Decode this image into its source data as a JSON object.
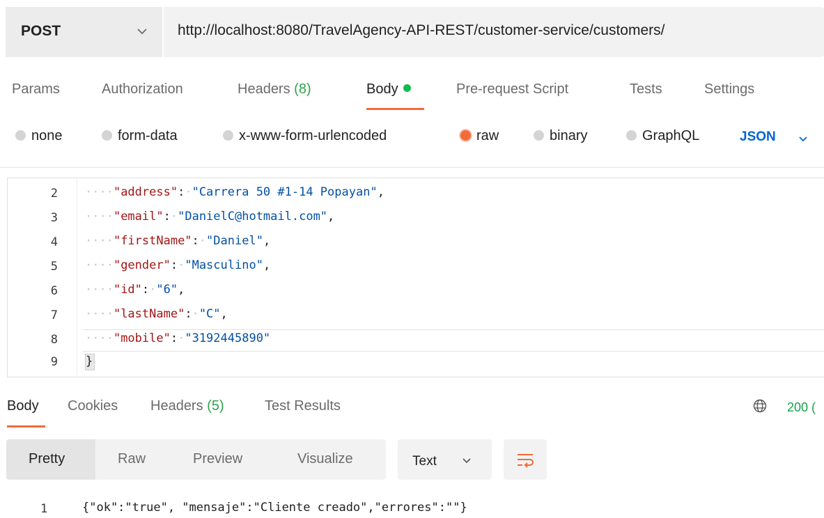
{
  "request": {
    "method": "POST",
    "url": "http://localhost:8080/TravelAgency-API-REST/customer-service/customers/"
  },
  "request_tabs": [
    {
      "label": "Params"
    },
    {
      "label": "Authorization"
    },
    {
      "label": "Headers",
      "count": "(8)"
    },
    {
      "label": "Body"
    },
    {
      "label": "Pre-request Script"
    },
    {
      "label": "Tests"
    },
    {
      "label": "Settings"
    }
  ],
  "body_types": [
    {
      "label": "none"
    },
    {
      "label": "form-data"
    },
    {
      "label": "x-www-form-urlencoded"
    },
    {
      "label": "raw"
    },
    {
      "label": "binary"
    },
    {
      "label": "GraphQL"
    }
  ],
  "body_format": "JSON",
  "editor": {
    "lines": [
      {
        "n": "2",
        "key": "\"address\"",
        "value": "\"Carrera 50 #1-14 Popayan\"",
        "tail": ","
      },
      {
        "n": "3",
        "key": "\"email\"",
        "value": "\"DanielC@hotmail.com\"",
        "tail": ","
      },
      {
        "n": "4",
        "key": "\"firstName\"",
        "value": "\"Daniel\"",
        "tail": ","
      },
      {
        "n": "5",
        "key": "\"gender\"",
        "value": "\"Masculino\"",
        "tail": ","
      },
      {
        "n": "6",
        "key": "\"id\"",
        "value": "\"6\"",
        "tail": ","
      },
      {
        "n": "7",
        "key": "\"lastName\"",
        "value": "\"C\"",
        "tail": ","
      },
      {
        "n": "8",
        "key": "\"mobile\"",
        "value": "\"3192445890\"",
        "tail": ""
      }
    ],
    "last_line": {
      "n": "9",
      "text": "}"
    }
  },
  "response_tabs": [
    {
      "label": "Body"
    },
    {
      "label": "Cookies"
    },
    {
      "label": "Headers",
      "count": "(5)"
    },
    {
      "label": "Test Results"
    }
  ],
  "response_status": "200 (",
  "view_modes": [
    "Pretty",
    "Raw",
    "Preview",
    "Visualize"
  ],
  "response_format": "Text",
  "response_body": {
    "line_number": "1",
    "text": "{\"ok\":\"true\", \"mensaje\":\"Cliente creado\",\"errores\":\"\"}"
  },
  "colors": {
    "accent": "#f26b3a",
    "json_blue": "#0265d2",
    "status_green": "#17a34a",
    "key_color": "#a31515",
    "string_color": "#0451a5"
  },
  "icons": [
    "chevron-down-icon",
    "globe-icon",
    "wrap-lines-icon"
  ]
}
